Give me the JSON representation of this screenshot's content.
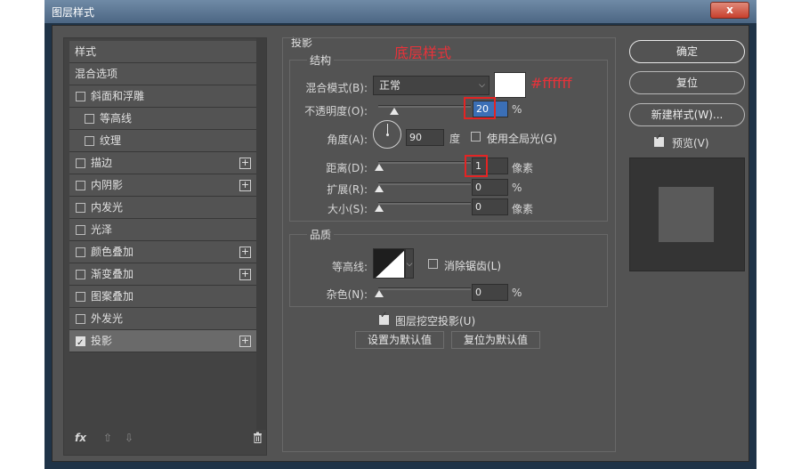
{
  "window": {
    "title": "图层样式",
    "close": "x"
  },
  "styles_list": [
    {
      "label": "样式",
      "type": "header"
    },
    {
      "label": "混合选项",
      "type": "header"
    },
    {
      "label": "斜面和浮雕",
      "type": "checkbox",
      "checked": false,
      "plus": false
    },
    {
      "label": "等高线",
      "type": "sub",
      "checked": false,
      "plus": false
    },
    {
      "label": "纹理",
      "type": "sub",
      "checked": false,
      "plus": false
    },
    {
      "label": "描边",
      "type": "checkbox",
      "checked": false,
      "plus": true
    },
    {
      "label": "内阴影",
      "type": "checkbox",
      "checked": false,
      "plus": true
    },
    {
      "label": "内发光",
      "type": "checkbox",
      "checked": false,
      "plus": false
    },
    {
      "label": "光泽",
      "type": "checkbox",
      "checked": false,
      "plus": false
    },
    {
      "label": "颜色叠加",
      "type": "checkbox",
      "checked": false,
      "plus": true
    },
    {
      "label": "渐变叠加",
      "type": "checkbox",
      "checked": false,
      "plus": true
    },
    {
      "label": "图案叠加",
      "type": "checkbox",
      "checked": false,
      "plus": false
    },
    {
      "label": "外发光",
      "type": "checkbox",
      "checked": false,
      "plus": false
    },
    {
      "label": "投影",
      "type": "checkbox",
      "checked": true,
      "plus": true,
      "active": true
    }
  ],
  "left_footer": {
    "fx": "fx",
    "up": "⇧",
    "down": "⇩",
    "trash": "🗑"
  },
  "drop_shadow": {
    "title": "投影",
    "annotation_title": "底层样式",
    "annotation_color": "#ffffff",
    "structure": {
      "title": "结构",
      "blend_mode_label": "混合模式(B):",
      "blend_mode_value": "正常",
      "opacity_label": "不透明度(O):",
      "opacity_value": "20",
      "opacity_unit": "%",
      "angle_label": "角度(A):",
      "angle_value": "90",
      "angle_unit": "度",
      "global_light_label": "使用全局光(G)",
      "distance_label": "距离(D):",
      "distance_value": "1",
      "distance_unit": "像素",
      "spread_label": "扩展(R):",
      "spread_value": "0",
      "spread_unit": "%",
      "size_label": "大小(S):",
      "size_value": "0",
      "size_unit": "像素"
    },
    "quality": {
      "title": "品质",
      "contour_label": "等高线:",
      "antialias_label": "消除锯齿(L)",
      "noise_label": "杂色(N):",
      "noise_value": "0",
      "noise_unit": "%"
    },
    "knockout_label": "图层挖空投影(U)",
    "make_default": "设置为默认值",
    "reset_default": "复位为默认值"
  },
  "right": {
    "ok": "确定",
    "reset": "复位",
    "new_style": "新建样式(W)...",
    "preview_label": "预览(V)"
  }
}
